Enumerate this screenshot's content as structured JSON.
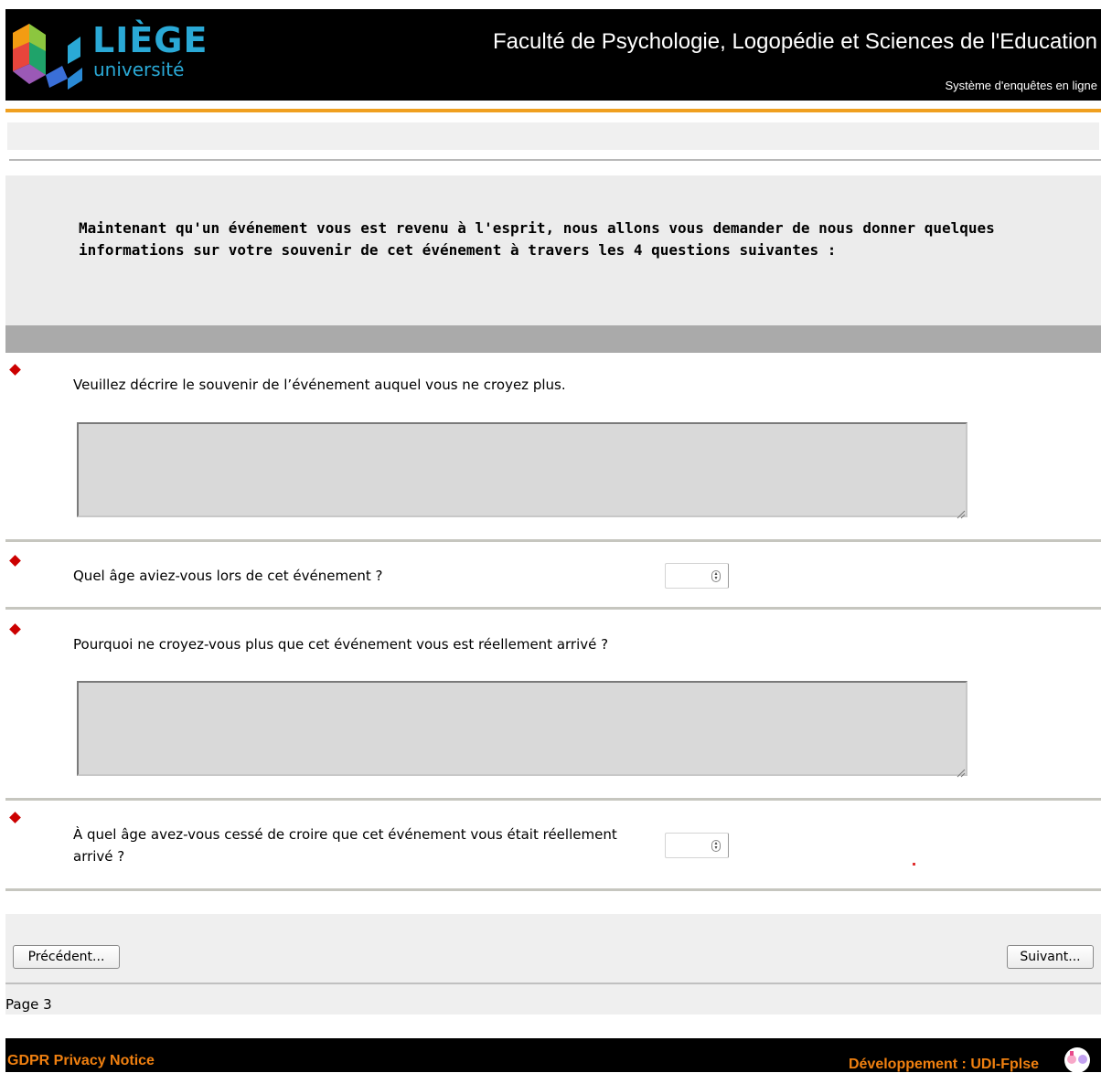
{
  "header": {
    "logo_line1": "LIÈGE",
    "logo_line2": "université",
    "faculty": "Faculté de Psychologie, Logopédie et Sciences de l'Education",
    "system": "Système d'enquêtes en ligne"
  },
  "intro": {
    "text": "Maintenant qu'un événement vous est revenu à l'esprit, nous allons vous demander de nous donner quelques informations sur votre souvenir de cet événement à travers les 4 questions suivantes :"
  },
  "questions": [
    {
      "label": "Veuillez décrire le souvenir de l’événement auquel vous ne croyez plus.",
      "type": "textarea",
      "value": ""
    },
    {
      "label": "Quel âge aviez-vous lors de cet événement ?",
      "type": "number",
      "value": ""
    },
    {
      "label": "Pourquoi ne croyez-vous plus que cet événement vous est réellement arrivé ?",
      "type": "textarea",
      "value": ""
    },
    {
      "label": "À quel âge avez-vous cessé de croire que cet événement vous était réellement arrivé ?",
      "type": "number",
      "value": ""
    }
  ],
  "nav": {
    "previous_label": "Précédent...",
    "next_label": "Suivant...",
    "page_label": "Page 3"
  },
  "footer": {
    "privacy_label": "GDPR Privacy Notice",
    "credit": "Développement : UDI-Fplse"
  },
  "colors": {
    "header_bg": "#000000",
    "accent_orange": "#f0a020",
    "logo_blue": "#2aa9d6",
    "required_marker": "#cc0000",
    "footer_text": "#f08010"
  },
  "icons": [
    "liege-logo-icon",
    "required-diamond-icon",
    "resize-grip-icon",
    "spinner-arrows-icon",
    "udi-logo-icon"
  ]
}
